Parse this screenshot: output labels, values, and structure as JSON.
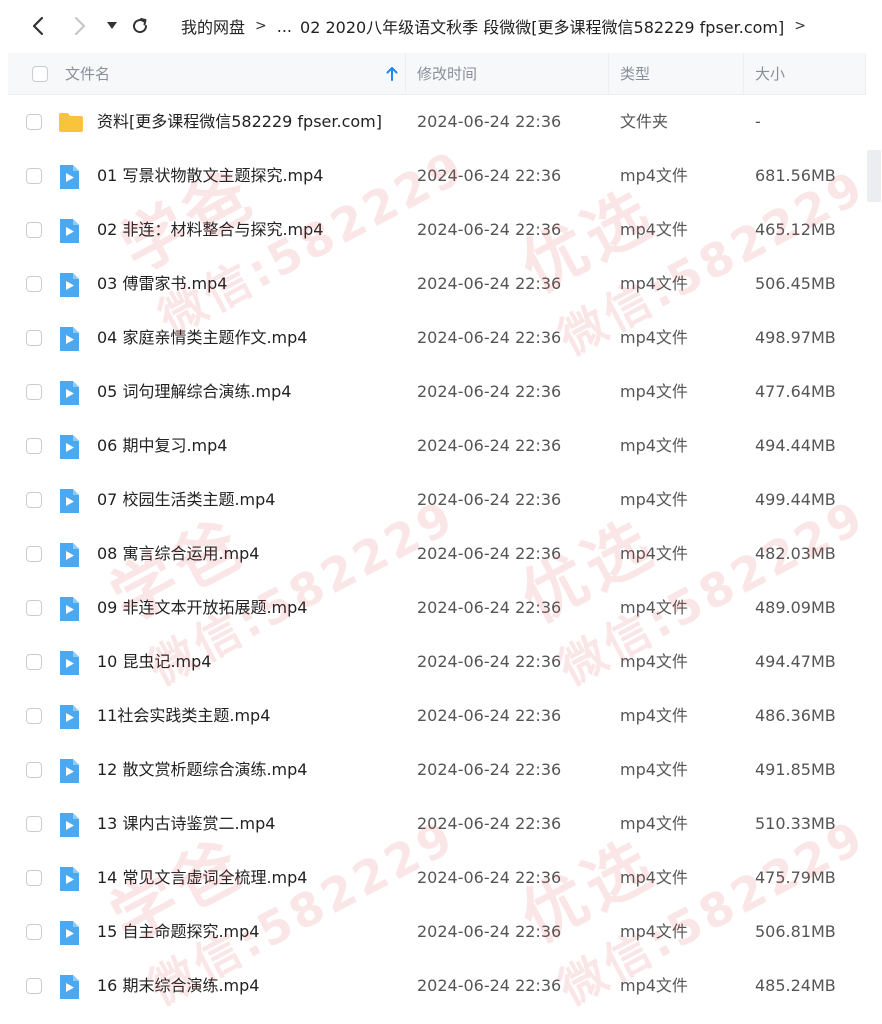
{
  "breadcrumb": {
    "root": "我的网盘",
    "ellipsis": "...",
    "current": "02 2020八年级语文秋季 段微微[更多课程微信582229 fpser.com]"
  },
  "columns": {
    "name": "文件名",
    "modified": "修改时间",
    "type": "类型",
    "size": "大小"
  },
  "files": [
    {
      "name": "资料[更多课程微信582229 fpser.com]",
      "time": "2024-06-24 22:36",
      "type": "文件夹",
      "size": "-",
      "icon": "folder-icon"
    },
    {
      "name": "01 写景状物散文主题探究.mp4",
      "time": "2024-06-24 22:36",
      "type": "mp4文件",
      "size": "681.56MB",
      "icon": "video-file-icon"
    },
    {
      "name": "02 非连：材料整合与探究.mp4",
      "time": "2024-06-24 22:36",
      "type": "mp4文件",
      "size": "465.12MB",
      "icon": "video-file-icon"
    },
    {
      "name": "03 傅雷家书.mp4",
      "time": "2024-06-24 22:36",
      "type": "mp4文件",
      "size": "506.45MB",
      "icon": "video-file-icon"
    },
    {
      "name": "04 家庭亲情类主题作文.mp4",
      "time": "2024-06-24 22:36",
      "type": "mp4文件",
      "size": "498.97MB",
      "icon": "video-file-icon"
    },
    {
      "name": "05 词句理解综合演练.mp4",
      "time": "2024-06-24 22:36",
      "type": "mp4文件",
      "size": "477.64MB",
      "icon": "video-file-icon"
    },
    {
      "name": "06 期中复习.mp4",
      "time": "2024-06-24 22:36",
      "type": "mp4文件",
      "size": "494.44MB",
      "icon": "video-file-icon"
    },
    {
      "name": "07 校园生活类主题.mp4",
      "time": "2024-06-24 22:36",
      "type": "mp4文件",
      "size": "499.44MB",
      "icon": "video-file-icon"
    },
    {
      "name": "08 寓言综合运用.mp4",
      "time": "2024-06-24 22:36",
      "type": "mp4文件",
      "size": "482.03MB",
      "icon": "video-file-icon"
    },
    {
      "name": "09 非连文本开放拓展题.mp4",
      "time": "2024-06-24 22:36",
      "type": "mp4文件",
      "size": "489.09MB",
      "icon": "video-file-icon"
    },
    {
      "name": "10 昆虫记.mp4",
      "time": "2024-06-24 22:36",
      "type": "mp4文件",
      "size": "494.47MB",
      "icon": "video-file-icon"
    },
    {
      "name": "11社会实践类主题.mp4",
      "time": "2024-06-24 22:36",
      "type": "mp4文件",
      "size": "486.36MB",
      "icon": "video-file-icon"
    },
    {
      "name": "12 散文赏析题综合演练.mp4",
      "time": "2024-06-24 22:36",
      "type": "mp4文件",
      "size": "491.85MB",
      "icon": "video-file-icon"
    },
    {
      "name": "13 课内古诗鉴赏二.mp4",
      "time": "2024-06-24 22:36",
      "type": "mp4文件",
      "size": "510.33MB",
      "icon": "video-file-icon"
    },
    {
      "name": "14 常见文言虚词全梳理.mp4",
      "time": "2024-06-24 22:36",
      "type": "mp4文件",
      "size": "475.79MB",
      "icon": "video-file-icon"
    },
    {
      "name": "15 自主命题探究.mp4",
      "time": "2024-06-24 22:36",
      "type": "mp4文件",
      "size": "506.81MB",
      "icon": "video-file-icon"
    },
    {
      "name": "16 期末综合演练.mp4",
      "time": "2024-06-24 22:36",
      "type": "mp4文件",
      "size": "485.24MB",
      "icon": "video-file-icon"
    }
  ],
  "watermark": {
    "line1": "学爸",
    "line2": "优选",
    "line3": "微信:582229"
  },
  "colors": {
    "video_icon": "#4aa9f0",
    "folder_icon": "#f9c33c",
    "sort_arrow": "#1e88f5"
  }
}
